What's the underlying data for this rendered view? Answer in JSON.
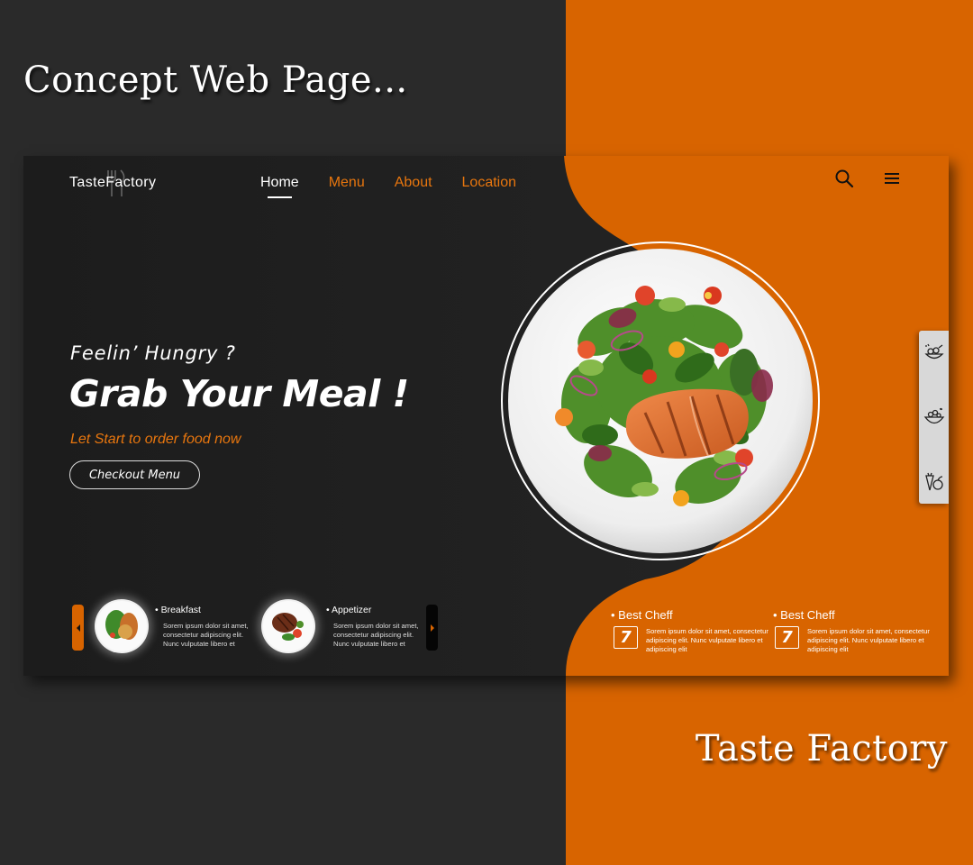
{
  "poster": {
    "title": "Concept Web Page...",
    "brand": "Taste Factory"
  },
  "colors": {
    "accent": "#d86400",
    "dark": "#222222",
    "nav_accent": "#e8760e"
  },
  "header": {
    "logo_text": "TasteFactory",
    "nav": [
      {
        "label": "Home",
        "active": true
      },
      {
        "label": "Menu",
        "active": false
      },
      {
        "label": "About",
        "active": false
      },
      {
        "label": "Location",
        "active": false
      }
    ],
    "icons": [
      "search-icon",
      "hamburger-menu-icon"
    ]
  },
  "hero": {
    "subtitle": "Feelin’ Hungry ?",
    "title": "Grab Your Meal !",
    "tagline": "Let Start to order food now",
    "cta_label": "Checkout Menu"
  },
  "side_panel": {
    "icons": [
      "salad-category-icon",
      "bowl-category-icon",
      "vegetables-category-icon"
    ]
  },
  "carousel": {
    "items": [
      {
        "title": "• Breakfast",
        "description": "Sorem ipsum dolor sit amet, consectetur adipiscing elit. Nunc vulputate libero et"
      },
      {
        "title": "• Appetizer",
        "description": "Sorem ipsum dolor sit amet, consectetur adipiscing elit. Nunc vulputate libero et"
      }
    ]
  },
  "chefs": [
    {
      "title": "• Best Cheff",
      "badge": "7",
      "description": "Sorem ipsum dolor sit amet, consectetur adipiscing elit. Nunc vulputate libero et adipiscing elit"
    },
    {
      "title": "• Best Cheff",
      "badge": "7",
      "description": "Sorem ipsum dolor sit amet, consectetur adipiscing elit. Nunc vulputate libero et adipiscing elit"
    }
  ]
}
